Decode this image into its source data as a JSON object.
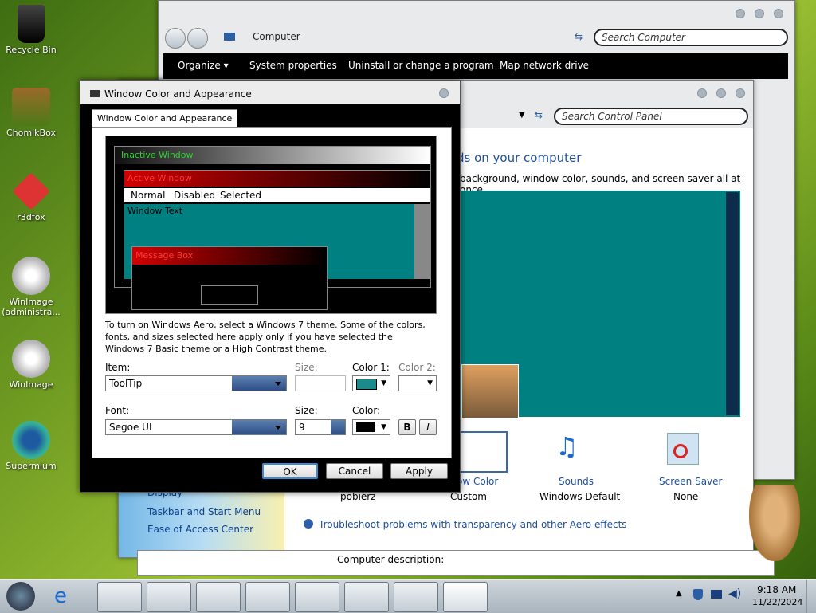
{
  "desktop": {
    "icons": [
      {
        "label": "Recycle Bin"
      },
      {
        "label": "ChomikBox"
      },
      {
        "label": "r3dfox"
      },
      {
        "label": "WinImage (administra..."
      },
      {
        "label": "WinImage"
      },
      {
        "label": "Supermium"
      }
    ]
  },
  "computer_window": {
    "breadcrumb": "Computer",
    "search_placeholder": "Search Computer",
    "toolbar": [
      "Organize ▾",
      "System properties",
      "Uninstall or change a program",
      "Map network drive"
    ]
  },
  "personalization_window": {
    "search_placeholder": "Search Control Panel",
    "heading": "ds on your computer",
    "subheading": "background, window color, sounds, and screen saver all at once.",
    "left_links": [
      "Display",
      "Taskbar and Start Menu",
      "Ease of Access Center"
    ],
    "bottom_items": [
      {
        "title": "pobierz",
        "subtitle": ""
      },
      {
        "title": "ow Color",
        "subtitle": "Custom"
      },
      {
        "title": "Sounds",
        "subtitle": "Windows Default"
      },
      {
        "title": "Screen Saver",
        "subtitle": "None"
      }
    ],
    "troubleshoot_link": "Troubleshoot problems with transparency and other Aero effects",
    "computer_description": "Computer description:"
  },
  "dialog": {
    "title": "Window Color and Appearance",
    "tab": "Window Color and Appearance",
    "preview": {
      "inactive_window": "Inactive Window",
      "active_window": "Active Window",
      "menu": [
        "Normal",
        "Disabled",
        "Selected"
      ],
      "window_text": "Window Text",
      "message_box": "Message Box"
    },
    "info_text": "To turn on Windows Aero, select a Windows 7 theme.  Some of the colors, fonts, and sizes selected here apply only if you have selected the Windows 7 Basic theme or a High Contrast theme.",
    "item_label": "Item:",
    "item_value": "ToolTip",
    "size_label": "Size:",
    "color1_label": "Color 1:",
    "color2_label": "Color 2:",
    "font_label": "Font:",
    "font_value": "Segoe UI",
    "font_size_label": "Size:",
    "font_size_value": "9",
    "font_color_label": "Color:",
    "bold_label": "B",
    "italic_label": "I",
    "ok_label": "OK",
    "cancel_label": "Cancel",
    "apply_label": "Apply",
    "colors": {
      "color1": "#1a8a8a",
      "font_color": "#000000",
      "teal_preview": "#008080",
      "active_red": "#d00000"
    }
  },
  "taskbar": {
    "time": "9:18 AM",
    "date": "11/22/2024"
  }
}
